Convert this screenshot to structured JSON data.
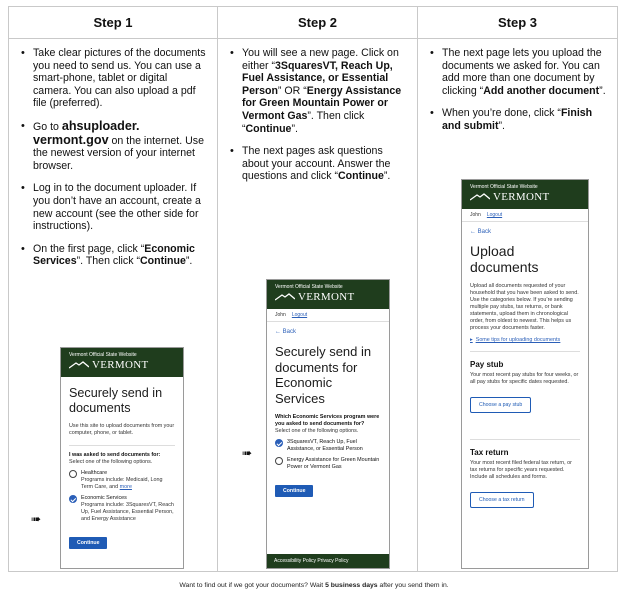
{
  "columns": [
    {
      "title": "Step 1"
    },
    {
      "title": "Step 2"
    },
    {
      "title": "Step 3"
    }
  ],
  "step1": {
    "b1": "Take clear pictures of the documents you need to send us. You can use a smart-phone, tablet or digital camera. You can also upload a pdf file (preferred).",
    "b2_pre": "Go to ",
    "b2_link": "ahsuploader. vermont.gov",
    "b2_post": " on the internet. Use the newest version of your internet browser.",
    "b3": "Log in to the document uploader. If you don’t have an account, create a new account (see the other side for instructions).",
    "b4_pre": "On the first page, click “",
    "b4_b1": "Economic Services",
    "b4_mid": "”. Then click “",
    "b4_b2": "Continue",
    "b4_post": "”."
  },
  "step2": {
    "b1_pre": "You will see a new page. Click on either “",
    "b1_b1": "3SquaresVT, Reach Up, Fuel Assistance, or Essential Person",
    "b1_mid": "” OR “",
    "b1_b2": "Energy Assistance for Green Mountain Power or Vermont Gas",
    "b1_mid2": "”. Then click “",
    "b1_b3": "Continue",
    "b1_post": "”.",
    "b2_pre": "The next pages ask questions about your account. Answer the questions and click “",
    "b2_b": "Continue",
    "b2_post": "”."
  },
  "step3": {
    "b1_pre": "The next page lets you upload the documents we asked for. You can add more than one document by clicking “",
    "b1_b": "Add another document",
    "b1_post": "”.",
    "b2_pre": "When you’re done, click “",
    "b2_b": "Finish and submit",
    "b2_post": "”."
  },
  "phone_common": {
    "site_label": "Vermont Official State Website",
    "logo_text": "VERMONT",
    "user": "John",
    "logout": "Logout",
    "back": "Back",
    "continue": "Continue"
  },
  "phone1": {
    "title": "Securely send in documents",
    "intro": "Use this site to upload documents from your computer, phone, or tablet.",
    "question": "I was asked to send documents for:",
    "select_hint": "Select one of the following options.",
    "opt1_title": "Healthcare",
    "opt1_desc_pre": "Programs include: Medicaid, Long Term Care, and ",
    "opt1_more": "more",
    "opt2_title": "Economic Services",
    "opt2_desc": "Programs include: 3SquaresVT, Reach Up, Fuel Assistance, Essential Person, and Energy Assistance"
  },
  "phone2": {
    "title": "Securely send in documents for Economic Services",
    "question": "Which Economic Services program were you asked to send documents for?",
    "select_hint": "Select one of the following options.",
    "opt1": "3SquaresVT, Reach Up, Fuel Assistance, or Essential Person",
    "opt2": "Energy Assistance for Green Mountain Power or Vermont Gas",
    "footer": "Accessibility Policy  Privacy Policy"
  },
  "phone3": {
    "title": "Upload documents",
    "intro": "Upload all documents requested of your household that you have been asked to send. Use the categories below. If you’re sending multiple pay stubs, tax returns, or bank statements, upload them in chronological order, from oldest to newest. This helps us process your documents faster.",
    "tips": "Some tips for uploading documents",
    "pay_title": "Pay stub",
    "pay_desc": "Your most recent pay stubs for four weeks, or all pay stubs for specific dates requested.",
    "pay_btn": "Choose a pay stub",
    "tax_title": "Tax return",
    "tax_desc": "Your most recent filed federal tax return, or tax returns for specific years requested. Include all schedules and forms.",
    "tax_btn": "Choose a tax return"
  },
  "note": {
    "pre": "Want to find out if we got your documents? Wait ",
    "b": "5 business days",
    "post": " after you send them in."
  }
}
